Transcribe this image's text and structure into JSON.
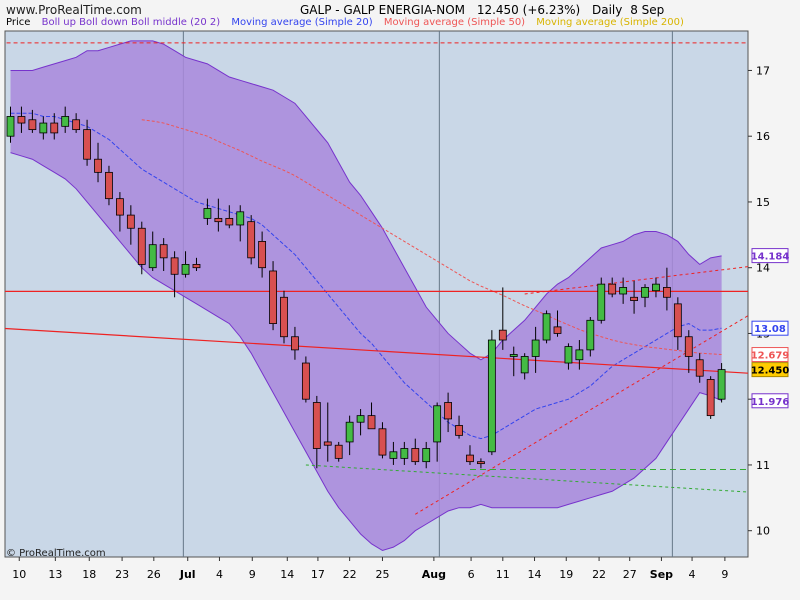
{
  "header": {
    "site": "www.ProRealTime.com",
    "title": "GALP - GALP ENERGIA-NOM",
    "last": "12.450 (+6.23%)",
    "period": "Daily",
    "date": "8 Sep"
  },
  "footer": {
    "copyright": "© ProRealTime.com"
  },
  "colors": {
    "panel": "#c9d7e7",
    "band": "#a988dc",
    "up": "#44bb44",
    "down": "#d85050",
    "ma20": "#3344ee",
    "ma50": "#ee5555",
    "ma200": "#d8b400",
    "boll": "#7733cc"
  },
  "chart_data": {
    "type": "candlestick",
    "ylim": [
      9.6,
      17.6
    ],
    "y_ticks": [
      10,
      11,
      12,
      13,
      14,
      15,
      16,
      17
    ],
    "x_ticks": [
      "10",
      "13",
      "18",
      "23",
      "26",
      "Jul",
      "4",
      "9",
      "14",
      "17",
      "22",
      "25",
      "Aug",
      "6",
      "11",
      "14",
      "19",
      "22",
      "27",
      "Sep",
      "4",
      "9"
    ],
    "legend": [
      {
        "label": "Price",
        "color": "#000000"
      },
      {
        "label": "Boll up Boll down Boll middle (20 2)",
        "color": "#7733cc"
      },
      {
        "label": "Moving average (Simple 20)",
        "color": "#3344ee"
      },
      {
        "label": "Moving average (Simple 50)",
        "color": "#ee5555"
      },
      {
        "label": "Moving average (Simple 200)",
        "color": "#d8b400"
      }
    ],
    "price_labels": [
      {
        "text": "14.184",
        "value": 14.184,
        "bg": "#ffffff",
        "fg": "#7733cc",
        "border": "#7733cc"
      },
      {
        "text": "13.08",
        "value": 13.08,
        "bg": "#ffffff",
        "fg": "#3344ee",
        "border": "#3344ee"
      },
      {
        "text": "12.679",
        "value": 12.679,
        "bg": "#ffffff",
        "fg": "#ee5555",
        "border": "#ee5555"
      },
      {
        "text": "12.450",
        "value": 12.45,
        "bg": "#ffcc00",
        "fg": "#000000",
        "border": "#aa8800"
      },
      {
        "text": "11.976",
        "value": 11.976,
        "bg": "#ffffff",
        "fg": "#7733cc",
        "border": "#7733cc"
      }
    ],
    "candles": [
      {
        "o": 16.0,
        "h": 16.45,
        "l": 15.9,
        "c": 16.3
      },
      {
        "o": 16.3,
        "h": 16.45,
        "l": 16.05,
        "c": 16.2
      },
      {
        "o": 16.25,
        "h": 16.4,
        "l": 16.05,
        "c": 16.1
      },
      {
        "o": 16.05,
        "h": 16.3,
        "l": 15.95,
        "c": 16.2
      },
      {
        "o": 16.2,
        "h": 16.35,
        "l": 15.95,
        "c": 16.05
      },
      {
        "o": 16.15,
        "h": 16.45,
        "l": 16.05,
        "c": 16.3
      },
      {
        "o": 16.25,
        "h": 16.35,
        "l": 16.05,
        "c": 16.1
      },
      {
        "o": 16.1,
        "h": 16.25,
        "l": 15.55,
        "c": 15.65
      },
      {
        "o": 15.65,
        "h": 15.9,
        "l": 15.3,
        "c": 15.45
      },
      {
        "o": 15.45,
        "h": 15.55,
        "l": 14.95,
        "c": 15.05
      },
      {
        "o": 15.05,
        "h": 15.15,
        "l": 14.55,
        "c": 14.8
      },
      {
        "o": 14.8,
        "h": 14.95,
        "l": 14.35,
        "c": 14.6
      },
      {
        "o": 14.6,
        "h": 14.7,
        "l": 13.9,
        "c": 14.05
      },
      {
        "o": 14.0,
        "h": 14.55,
        "l": 13.95,
        "c": 14.35
      },
      {
        "o": 14.35,
        "h": 14.45,
        "l": 13.95,
        "c": 14.15
      },
      {
        "o": 14.15,
        "h": 14.25,
        "l": 13.55,
        "c": 13.9
      },
      {
        "o": 13.9,
        "h": 14.25,
        "l": 13.85,
        "c": 14.05
      },
      {
        "o": 14.05,
        "h": 14.15,
        "l": 13.95,
        "c": 14.0
      },
      {
        "o": 14.75,
        "h": 15.05,
        "l": 14.65,
        "c": 14.9
      },
      {
        "o": 14.75,
        "h": 15.05,
        "l": 14.55,
        "c": 14.7
      },
      {
        "o": 14.75,
        "h": 14.95,
        "l": 14.6,
        "c": 14.65
      },
      {
        "o": 14.65,
        "h": 14.95,
        "l": 14.4,
        "c": 14.85
      },
      {
        "o": 14.7,
        "h": 14.8,
        "l": 14.05,
        "c": 14.15
      },
      {
        "o": 14.4,
        "h": 14.55,
        "l": 13.85,
        "c": 14.0
      },
      {
        "o": 13.95,
        "h": 14.1,
        "l": 13.05,
        "c": 13.15
      },
      {
        "o": 13.55,
        "h": 13.65,
        "l": 12.85,
        "c": 12.95
      },
      {
        "o": 12.95,
        "h": 13.1,
        "l": 12.6,
        "c": 12.75
      },
      {
        "o": 12.55,
        "h": 12.65,
        "l": 11.95,
        "c": 12.0
      },
      {
        "o": 11.95,
        "h": 12.05,
        "l": 10.95,
        "c": 11.25
      },
      {
        "o": 11.35,
        "h": 11.95,
        "l": 11.05,
        "c": 11.3
      },
      {
        "o": 11.3,
        "h": 11.35,
        "l": 11.05,
        "c": 11.1
      },
      {
        "o": 11.35,
        "h": 11.75,
        "l": 11.15,
        "c": 11.65
      },
      {
        "o": 11.65,
        "h": 11.85,
        "l": 11.45,
        "c": 11.75
      },
      {
        "o": 11.75,
        "h": 11.95,
        "l": 11.55,
        "c": 11.55
      },
      {
        "o": 11.55,
        "h": 11.65,
        "l": 11.1,
        "c": 11.15
      },
      {
        "o": 11.1,
        "h": 11.35,
        "l": 11.0,
        "c": 11.2
      },
      {
        "o": 11.1,
        "h": 11.35,
        "l": 11.0,
        "c": 11.25
      },
      {
        "o": 11.25,
        "h": 11.4,
        "l": 11.0,
        "c": 11.05
      },
      {
        "o": 11.05,
        "h": 11.35,
        "l": 10.95,
        "c": 11.25
      },
      {
        "o": 11.35,
        "h": 11.95,
        "l": 11.05,
        "c": 11.9
      },
      {
        "o": 11.95,
        "h": 12.1,
        "l": 11.5,
        "c": 11.7
      },
      {
        "o": 11.6,
        "h": 11.75,
        "l": 11.4,
        "c": 11.45
      },
      {
        "o": 11.15,
        "h": 11.3,
        "l": 11.0,
        "c": 11.05
      },
      {
        "o": 11.05,
        "h": 11.1,
        "l": 10.95,
        "c": 11.02
      },
      {
        "o": 11.2,
        "h": 13.05,
        "l": 11.15,
        "c": 12.9
      },
      {
        "o": 13.05,
        "h": 13.7,
        "l": 12.75,
        "c": 12.9
      },
      {
        "o": 12.65,
        "h": 12.8,
        "l": 12.35,
        "c": 12.68
      },
      {
        "o": 12.4,
        "h": 12.7,
        "l": 12.3,
        "c": 12.65
      },
      {
        "o": 12.65,
        "h": 13.1,
        "l": 12.4,
        "c": 12.9
      },
      {
        "o": 12.9,
        "h": 13.35,
        "l": 12.85,
        "c": 13.3
      },
      {
        "o": 13.1,
        "h": 13.35,
        "l": 12.95,
        "c": 13.0
      },
      {
        "o": 12.55,
        "h": 12.85,
        "l": 12.45,
        "c": 12.8
      },
      {
        "o": 12.6,
        "h": 12.9,
        "l": 12.45,
        "c": 12.75
      },
      {
        "o": 12.75,
        "h": 13.25,
        "l": 12.65,
        "c": 13.2
      },
      {
        "o": 13.2,
        "h": 13.85,
        "l": 13.15,
        "c": 13.75
      },
      {
        "o": 13.75,
        "h": 13.85,
        "l": 13.55,
        "c": 13.6
      },
      {
        "o": 13.6,
        "h": 13.85,
        "l": 13.45,
        "c": 13.7
      },
      {
        "o": 13.55,
        "h": 13.8,
        "l": 13.3,
        "c": 13.5
      },
      {
        "o": 13.55,
        "h": 13.75,
        "l": 13.4,
        "c": 13.7
      },
      {
        "o": 13.65,
        "h": 13.85,
        "l": 13.55,
        "c": 13.75
      },
      {
        "o": 13.7,
        "h": 14.0,
        "l": 13.35,
        "c": 13.55
      },
      {
        "o": 13.45,
        "h": 13.55,
        "l": 12.75,
        "c": 12.95
      },
      {
        "o": 12.95,
        "h": 13.05,
        "l": 12.4,
        "c": 12.65
      },
      {
        "o": 12.6,
        "h": 12.7,
        "l": 12.25,
        "c": 12.35
      },
      {
        "o": 12.3,
        "h": 12.35,
        "l": 11.7,
        "c": 11.75
      },
      {
        "o": 12.0,
        "h": 12.55,
        "l": 11.95,
        "c": 12.45
      }
    ],
    "bollinger": {
      "upper": [
        17.0,
        17.0,
        17.0,
        17.05,
        17.1,
        17.15,
        17.2,
        17.3,
        17.3,
        17.35,
        17.4,
        17.45,
        17.45,
        17.45,
        17.4,
        17.3,
        17.2,
        17.15,
        17.1,
        17.0,
        16.9,
        16.85,
        16.8,
        16.75,
        16.7,
        16.6,
        16.5,
        16.3,
        16.1,
        15.9,
        15.6,
        15.3,
        15.1,
        14.85,
        14.6,
        14.3,
        14.0,
        13.7,
        13.4,
        13.2,
        13.0,
        12.85,
        12.7,
        12.6,
        12.7,
        12.9,
        13.05,
        13.2,
        13.4,
        13.6,
        13.75,
        13.85,
        14.0,
        14.15,
        14.3,
        14.35,
        14.4,
        14.5,
        14.55,
        14.55,
        14.5,
        14.4,
        14.2,
        14.05,
        14.15,
        14.18
      ],
      "middle": [
        16.35,
        16.35,
        16.35,
        16.3,
        16.3,
        16.25,
        16.2,
        16.15,
        16.05,
        15.95,
        15.8,
        15.65,
        15.5,
        15.4,
        15.3,
        15.2,
        15.1,
        15.0,
        14.95,
        14.9,
        14.85,
        14.8,
        14.75,
        14.65,
        14.5,
        14.35,
        14.2,
        14.0,
        13.8,
        13.6,
        13.4,
        13.2,
        13.0,
        12.85,
        12.65,
        12.45,
        12.25,
        12.1,
        11.95,
        11.8,
        11.65,
        11.55,
        11.45,
        11.4,
        11.45,
        11.55,
        11.65,
        11.75,
        11.85,
        11.9,
        11.95,
        12.0,
        12.1,
        12.2,
        12.35,
        12.5,
        12.6,
        12.7,
        12.8,
        12.9,
        13.0,
        13.1,
        13.15,
        13.05,
        13.05,
        13.08
      ],
      "lower": [
        15.75,
        15.7,
        15.65,
        15.55,
        15.45,
        15.35,
        15.2,
        15.0,
        14.8,
        14.6,
        14.4,
        14.2,
        14.0,
        13.85,
        13.75,
        13.65,
        13.55,
        13.45,
        13.35,
        13.25,
        13.15,
        12.95,
        12.7,
        12.4,
        12.1,
        11.8,
        11.5,
        11.2,
        10.9,
        10.6,
        10.35,
        10.15,
        9.95,
        9.8,
        9.7,
        9.75,
        9.85,
        10.0,
        10.1,
        10.2,
        10.3,
        10.35,
        10.35,
        10.4,
        10.35,
        10.35,
        10.35,
        10.35,
        10.35,
        10.35,
        10.35,
        10.4,
        10.45,
        10.5,
        10.55,
        10.6,
        10.7,
        10.8,
        10.95,
        11.1,
        11.35,
        11.6,
        11.85,
        12.1,
        12.05,
        11.98
      ]
    },
    "ma50": {
      "start": 12,
      "values": [
        16.25,
        16.23,
        16.2,
        16.15,
        16.1,
        16.05,
        16.0,
        15.92,
        15.85,
        15.78,
        15.7,
        15.62,
        15.55,
        15.48,
        15.4,
        15.3,
        15.2,
        15.1,
        15.0,
        14.9,
        14.8,
        14.7,
        14.6,
        14.5,
        14.4,
        14.3,
        14.2,
        14.1,
        14.0,
        13.9,
        13.8,
        13.72,
        13.65,
        13.58,
        13.5,
        13.42,
        13.35,
        13.28,
        13.2,
        13.13,
        13.06,
        13.0,
        12.95,
        12.9,
        12.86,
        12.83,
        12.8,
        12.78,
        12.76,
        12.74,
        12.72,
        12.7,
        12.69,
        12.68
      ]
    },
    "trendlines": [
      {
        "from": [
          -1,
          13.08
        ],
        "to": [
          72,
          12.35
        ],
        "color": "#ee2222",
        "width": 1.2,
        "dash": ""
      },
      {
        "from": [
          -1,
          13.64
        ],
        "to": [
          72,
          13.64
        ],
        "color": "#ee2222",
        "width": 1.2,
        "dash": ""
      },
      {
        "from": [
          -1,
          17.42
        ],
        "to": [
          72,
          17.42
        ],
        "color": "#ee2222",
        "width": 1,
        "dash": "4,3"
      },
      {
        "from": [
          37,
          10.25
        ],
        "to": [
          79,
          14.42
        ],
        "color": "#ee2222",
        "width": 1,
        "dash": "3,3"
      },
      {
        "from": [
          47,
          13.6
        ],
        "to": [
          74,
          14.15
        ],
        "color": "#ee2222",
        "width": 1,
        "dash": "3,3"
      },
      {
        "from": [
          27,
          11.0
        ],
        "to": [
          81,
          10.45
        ],
        "color": "#33aa33",
        "width": 1,
        "dash": "3,3"
      },
      {
        "from": [
          42,
          10.93
        ],
        "to": [
          81,
          10.93
        ],
        "color": "#33aa33",
        "width": 1,
        "dash": "6,4"
      }
    ]
  }
}
